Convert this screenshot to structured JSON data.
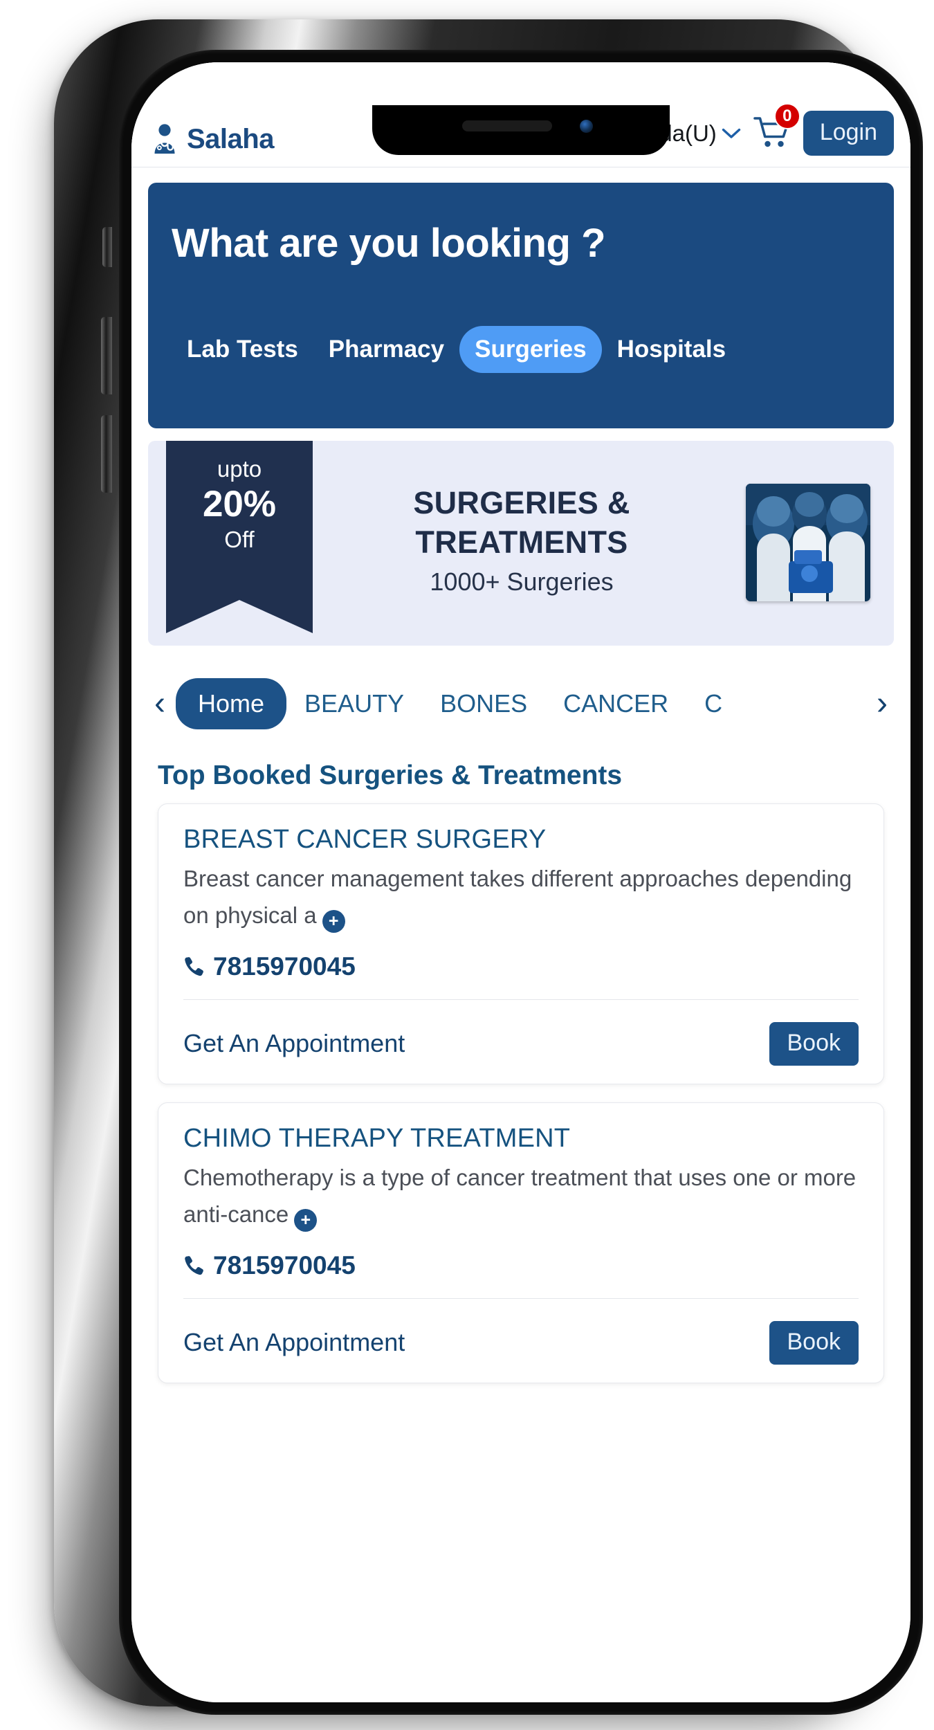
{
  "header": {
    "brand_name": "Salaha",
    "brand_icon": "doctor-icon",
    "location": "Kakinada(U)",
    "location_icon": "map-pin-icon",
    "chevron_icon": "chevron-down-icon",
    "cart_icon": "shopping-cart-icon",
    "cart_count": "0",
    "login_label": "Login"
  },
  "hero": {
    "title": "What are you looking ?",
    "tabs": [
      {
        "label": "Lab Tests",
        "active": false
      },
      {
        "label": "Pharmacy",
        "active": false
      },
      {
        "label": "Surgeries",
        "active": true
      },
      {
        "label": "Hospitals",
        "active": false
      }
    ],
    "bg_color": "#1b4a80",
    "active_tab_color": "#4f9cf5"
  },
  "promo": {
    "ribbon_upto": "upto",
    "ribbon_percent": "20%",
    "ribbon_off": "Off",
    "heading_line1": "SURGERIES &",
    "heading_line2": "TREATMENTS",
    "subtext": "1000+ Surgeries",
    "photo_alt": "surgery-operating-room-photo",
    "bg_color": "#e9ecf8",
    "ribbon_color": "#20304f"
  },
  "categories": {
    "prev_icon": "chevron-left-icon",
    "next_icon": "chevron-right-icon",
    "items": [
      {
        "label": "Home",
        "active": true
      },
      {
        "label": "BEAUTY",
        "active": false
      },
      {
        "label": "BONES",
        "active": false
      },
      {
        "label": "CANCER",
        "active": false
      },
      {
        "label": "C",
        "active": false
      }
    ]
  },
  "section": {
    "title": "Top Booked Surgeries & Treatments"
  },
  "cards": [
    {
      "title": "BREAST CANCER SURGERY",
      "description": "Breast cancer management takes different approaches depending on physical a",
      "expand_icon": "plus-icon",
      "phone_icon": "phone-icon",
      "phone": "7815970045",
      "appointment_label": "Get An Appointment",
      "book_label": "Book"
    },
    {
      "title": "CHIMO THERAPY TREATMENT",
      "description": "Chemotherapy is a type of cancer treatment that uses one or more anti-cance",
      "expand_icon": "plus-icon",
      "phone_icon": "phone-icon",
      "phone": "7815970045",
      "appointment_label": "Get An Appointment",
      "book_label": "Book"
    }
  ]
}
